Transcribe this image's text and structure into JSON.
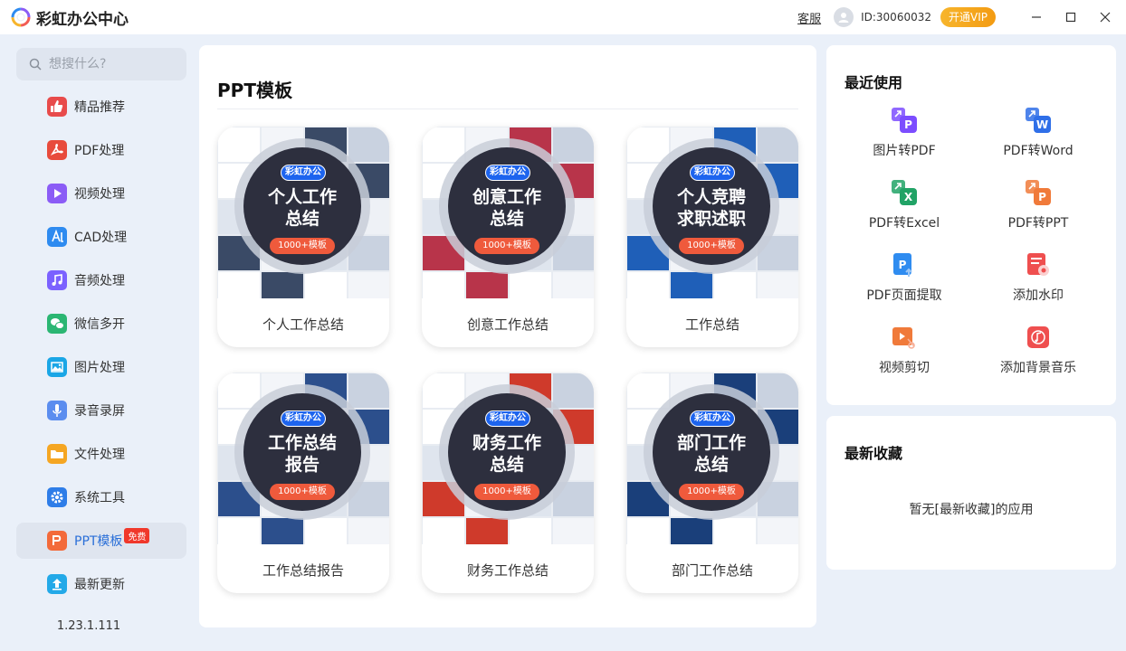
{
  "app": {
    "title": "彩虹办公中心",
    "support_label": "客服",
    "user_id": "ID:30060032",
    "vip_label": "开通VIP"
  },
  "sidebar": {
    "search_placeholder": "想搜什么?",
    "items": [
      {
        "label": "精品推荐",
        "icon": "thumbs-up-icon",
        "color": "#e84b4b"
      },
      {
        "label": "PDF处理",
        "icon": "pdf-icon",
        "color": "#e84b3c"
      },
      {
        "label": "视频处理",
        "icon": "video-play-icon",
        "color": "#8b5cf6"
      },
      {
        "label": "CAD处理",
        "icon": "cad-icon",
        "color": "#2e8bf0"
      },
      {
        "label": "音频处理",
        "icon": "music-note-icon",
        "color": "#7b61ff"
      },
      {
        "label": "微信多开",
        "icon": "wechat-icon",
        "color": "#2bb673"
      },
      {
        "label": "图片处理",
        "icon": "image-icon",
        "color": "#1aa6e6"
      },
      {
        "label": "录音录屏",
        "icon": "microphone-icon",
        "color": "#5b8def"
      },
      {
        "label": "文件处理",
        "icon": "folder-icon",
        "color": "#f5a623"
      },
      {
        "label": "系统工具",
        "icon": "gear-icon",
        "color": "#2e7de8"
      },
      {
        "label": "PPT模板",
        "icon": "ppt-icon",
        "color": "#f36a3a",
        "badge": "免费"
      },
      {
        "label": "最新更新",
        "icon": "upload-arrow-icon",
        "color": "#23a9e8"
      }
    ],
    "version": "1.23.1.111"
  },
  "main": {
    "title": "PPT模板",
    "cards": [
      {
        "brand": "彩虹办公",
        "title_line1": "个人工作",
        "title_line2": "总结",
        "count": "1000+模板",
        "label": "个人工作总结",
        "tone": "#3a4a66"
      },
      {
        "brand": "彩虹办公",
        "title_line1": "创意工作",
        "title_line2": "总结",
        "count": "1000+模板",
        "label": "创意工作总结",
        "tone": "#b8344a"
      },
      {
        "brand": "彩虹办公",
        "title_line1": "个人竞聘",
        "title_line2": "求职述职",
        "count": "1000+模板",
        "label": "工作总结",
        "tone": "#1f5fb8"
      },
      {
        "brand": "彩虹办公",
        "title_line1": "工作总结",
        "title_line2": "报告",
        "count": "1000+模板",
        "label": "工作总结报告",
        "tone": "#2c4f8c"
      },
      {
        "brand": "彩虹办公",
        "title_line1": "财务工作",
        "title_line2": "总结",
        "count": "1000+模板",
        "label": "财务工作总结",
        "tone": "#cf3a2b"
      },
      {
        "brand": "彩虹办公",
        "title_line1": "部门工作",
        "title_line2": "总结",
        "count": "1000+模板",
        "label": "部门工作总结",
        "tone": "#1a3f7a"
      }
    ]
  },
  "recent": {
    "title": "最近使用",
    "tools": [
      {
        "label": "图片转PDF",
        "icon": "image-to-pdf-icon",
        "color": "#7c4dff"
      },
      {
        "label": "PDF转Word",
        "icon": "pdf-to-word-icon",
        "color": "#2f6fe8"
      },
      {
        "label": "PDF转Excel",
        "icon": "pdf-to-excel-icon",
        "color": "#21a366"
      },
      {
        "label": "PDF转PPT",
        "icon": "pdf-to-ppt-icon",
        "color": "#f07a3a"
      },
      {
        "label": "PDF页面提取",
        "icon": "pdf-page-extract-icon",
        "color": "#2f8cf0"
      },
      {
        "label": "添加水印",
        "icon": "watermark-icon",
        "color": "#ef4f4f"
      },
      {
        "label": "视频剪切",
        "icon": "video-cut-icon",
        "color": "#f07a3a"
      },
      {
        "label": "添加背景音乐",
        "icon": "background-music-icon",
        "color": "#ef4f4f"
      }
    ]
  },
  "favorites": {
    "title": "最新收藏",
    "empty_text": "暂无[最新收藏]的应用"
  }
}
